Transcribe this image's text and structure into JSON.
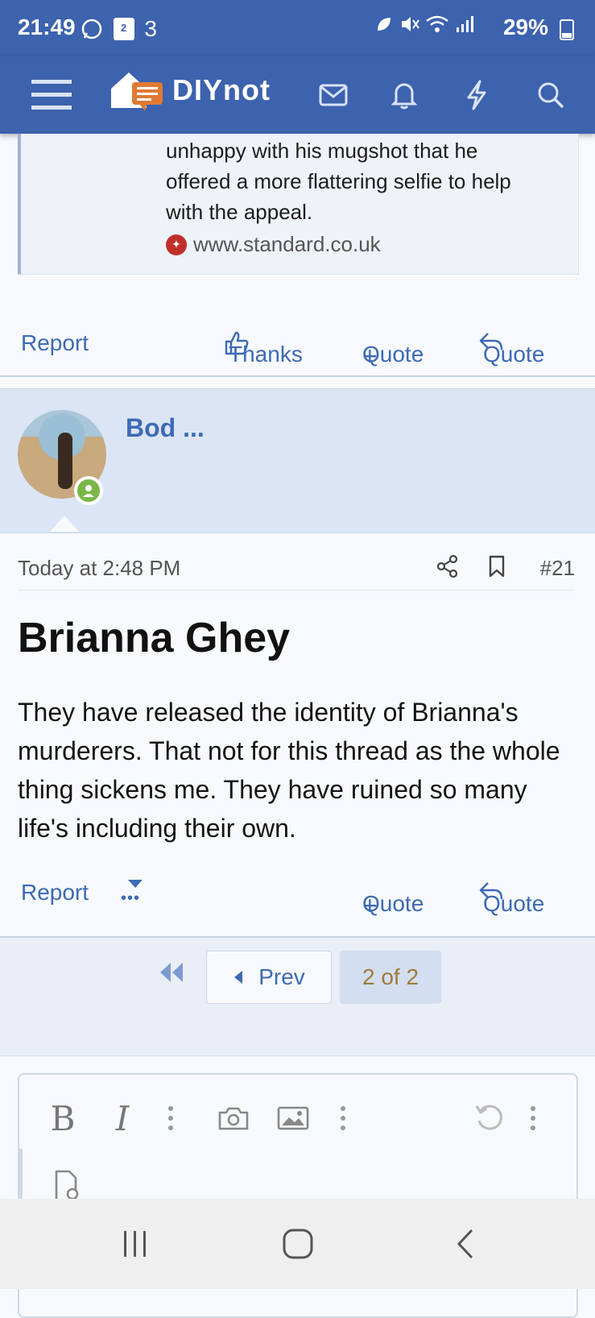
{
  "status_bar": {
    "time": "21:49",
    "left_icons": [
      "whatsapp-icon",
      "calendar-icon",
      "three-network-icon"
    ],
    "calendar_day": "2",
    "battery": "29%"
  },
  "header": {
    "site_name": "DIYnot",
    "icons": [
      "menu-icon",
      "mail-icon",
      "bell-icon",
      "lightning-icon",
      "search-icon"
    ]
  },
  "quote_snippet": {
    "text_lines": [
      "unhappy with his mugshot that he",
      "offered a more flattering selfie to help",
      "with the appeal."
    ],
    "source": "www.standard.co.uk"
  },
  "post_actions_prev": {
    "report": "Report",
    "thanks": "Thanks",
    "plus_quote": "Quote",
    "reply_quote": "Quote"
  },
  "post": {
    "username": "Bod ...",
    "timestamp": "Today at 2:48 PM",
    "post_number": "#21",
    "title": "Brianna Ghey",
    "body": "They have released the identity of Brianna's murderers. That not for this thread as the whole thing sickens me. They have ruined so many life's including their own.",
    "actions": {
      "report": "Report",
      "more": "•••",
      "plus_quote": "Quote",
      "reply_quote": "Quote"
    }
  },
  "pagination": {
    "prev_label": "Prev",
    "page_indicator": "2 of 2"
  },
  "editor": {
    "toolbar": [
      "bold-icon",
      "italic-icon",
      "more-options-icon",
      "camera-icon",
      "image-icon",
      "more-options-icon",
      "undo-icon",
      "more-options-icon"
    ],
    "bold_label": "B",
    "italic_label": "I"
  },
  "colors": {
    "header_bg": "#3d62ae",
    "link": "#3d6ab4",
    "post_header_bg": "#dbe5f5",
    "online_badge": "#7ab648",
    "page_current": "#a07a3c"
  }
}
